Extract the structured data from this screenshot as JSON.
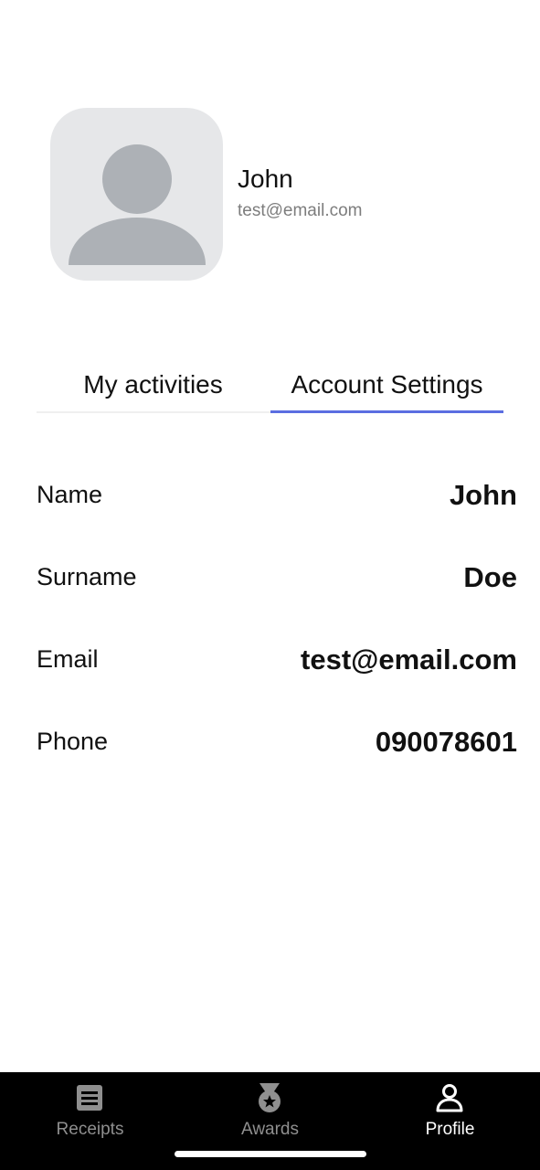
{
  "profile": {
    "name": "John",
    "email": "test@email.com",
    "avatar_icon": "user-placeholder-icon"
  },
  "tabs": [
    {
      "label": "My activities",
      "active": false
    },
    {
      "label": "Account Settings",
      "active": true
    }
  ],
  "account_settings": [
    {
      "label": "Name",
      "value": "John"
    },
    {
      "label": "Surname",
      "value": "Doe"
    },
    {
      "label": "Email",
      "value": "test@email.com"
    },
    {
      "label": "Phone",
      "value": "090078601"
    }
  ],
  "bottom_nav": [
    {
      "label": "Receipts",
      "icon": "receipt-icon",
      "active": false
    },
    {
      "label": "Awards",
      "icon": "award-medal-icon",
      "active": false
    },
    {
      "label": "Profile",
      "icon": "profile-person-icon",
      "active": true
    }
  ],
  "colors": {
    "accent": "#5b6ee1",
    "nav_background": "#000000",
    "nav_inactive": "#8f8f8f",
    "nav_active": "#ffffff",
    "avatar_background": "#e6e7e9",
    "avatar_silhouette": "#adb1b6"
  }
}
